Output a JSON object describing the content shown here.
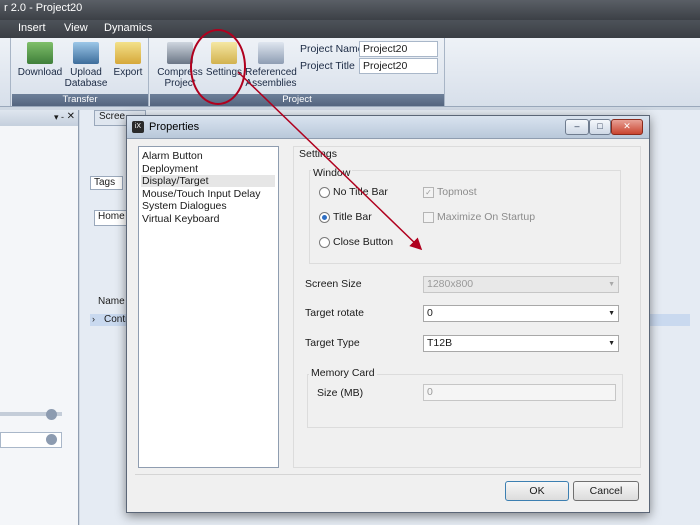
{
  "app": {
    "title": "r 2.0 - Project20",
    "menu": [
      "Insert",
      "View",
      "Dynamics"
    ]
  },
  "ribbon": {
    "transfer_group": {
      "label": "Transfer",
      "buttons": [
        {
          "label": "Download",
          "icon": "download-icon"
        },
        {
          "label": "Upload Database",
          "icon": "upload-database-icon"
        },
        {
          "label": "Export",
          "icon": "export-icon"
        }
      ]
    },
    "project_group": {
      "label": "Project",
      "buttons": [
        {
          "label": "Compress Project",
          "icon": "compress-project-icon"
        },
        {
          "label": "Settings",
          "icon": "settings-icon"
        },
        {
          "label": "Referenced Assemblies",
          "icon": "referenced-assemblies-icon"
        }
      ],
      "project_name_label": "Project Name",
      "project_name": "Project20",
      "project_title_label": "Project Title",
      "project_title": "Project20"
    }
  },
  "background": {
    "tab_screen": "Scree",
    "tab_tags": "Tags",
    "tab_home": "Home",
    "col_name": "Name",
    "row_control": "Contr"
  },
  "dialog": {
    "title": "Properties",
    "logo": "iX",
    "nav": [
      "Alarm Button",
      "Deployment",
      "Display/Target",
      "Mouse/Touch Input Delay",
      "System Dialogues",
      "Virtual Keyboard"
    ],
    "selected_nav": "Display/Target",
    "settings_caption": "Settings",
    "window_caption": "Window",
    "radios": [
      {
        "label": "No Title Bar",
        "selected": false
      },
      {
        "label": "Title Bar",
        "selected": true
      },
      {
        "label": "Close Button",
        "selected": false
      }
    ],
    "checkboxes": [
      {
        "label": "Topmost",
        "checked": true,
        "disabled": true
      },
      {
        "label": "Maximize On Startup",
        "checked": false,
        "disabled": true
      }
    ],
    "screen_size_label": "Screen Size",
    "screen_size_value": "1280x800",
    "target_rotate_label": "Target rotate",
    "target_rotate_value": "0",
    "target_type_label": "Target Type",
    "target_type_value": "T12B",
    "memory_card_caption": "Memory Card",
    "size_mb_label": "Size (MB)",
    "size_mb_value": "0",
    "ok_label": "OK",
    "cancel_label": "Cancel"
  },
  "colors": {
    "annotation_red": "#b0001e",
    "accent_blue": "#2f6fc4"
  }
}
